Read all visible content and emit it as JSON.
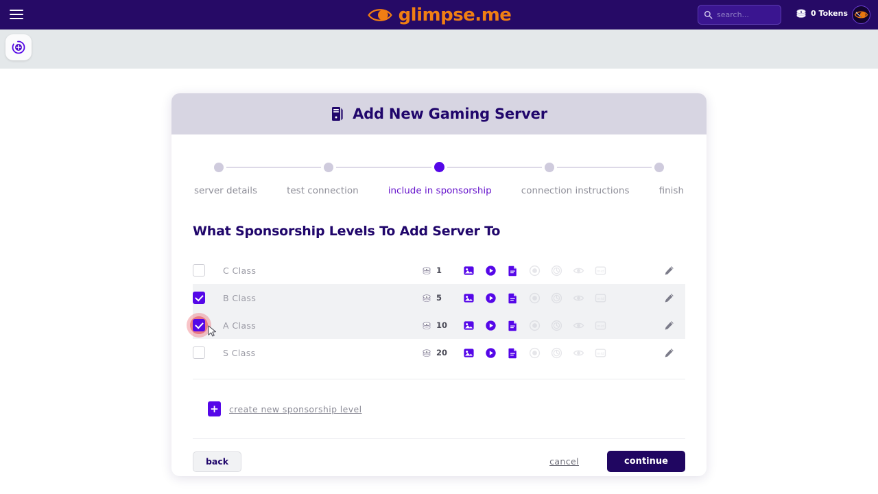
{
  "topbar": {
    "menu_icon": "hamburger-icon",
    "brand": "glimpse.me",
    "brand_icon": "eye-logo-icon",
    "search": {
      "value": "",
      "placeholder": "search..."
    },
    "tokens_label": "0 Tokens",
    "tokens_icon": "coin-stack-icon",
    "avatar_icon": "user-avatar-eye-icon"
  },
  "fab": {
    "icon": "add-circle-icon"
  },
  "modal": {
    "title": "Add New Gaming Server",
    "title_icon": "server-tower-icon",
    "stepper": {
      "active_index": 2,
      "steps": [
        {
          "label": "server details"
        },
        {
          "label": "test connection"
        },
        {
          "label": "include in sponsorship"
        },
        {
          "label": "connection instructions"
        },
        {
          "label": "finish"
        }
      ]
    },
    "section_title": "What Sponsorship Levels To Add Server To",
    "levels": [
      {
        "name": "C Class",
        "checked": false,
        "shaded": false,
        "cost": "1",
        "features": [
          {
            "icon": "image-icon",
            "enabled": true
          },
          {
            "icon": "video-play-icon",
            "enabled": true
          },
          {
            "icon": "document-icon",
            "enabled": true
          },
          {
            "icon": "audio-record-icon",
            "enabled": false
          },
          {
            "icon": "audio-clock-icon",
            "enabled": false
          },
          {
            "icon": "eye-view-icon",
            "enabled": false
          },
          {
            "icon": "midi-icon",
            "enabled": false
          }
        ],
        "edit_icon": "pencil-icon"
      },
      {
        "name": "B Class",
        "checked": true,
        "shaded": true,
        "cost": "5",
        "features": [
          {
            "icon": "image-icon",
            "enabled": true
          },
          {
            "icon": "video-play-icon",
            "enabled": true
          },
          {
            "icon": "document-icon",
            "enabled": true
          },
          {
            "icon": "audio-record-icon",
            "enabled": false
          },
          {
            "icon": "audio-clock-icon",
            "enabled": false
          },
          {
            "icon": "eye-view-icon",
            "enabled": false
          },
          {
            "icon": "midi-icon",
            "enabled": false
          }
        ],
        "edit_icon": "pencil-icon"
      },
      {
        "name": "A Class",
        "checked": true,
        "shaded": true,
        "cost": "10",
        "clicked": true,
        "features": [
          {
            "icon": "image-icon",
            "enabled": true
          },
          {
            "icon": "video-play-icon",
            "enabled": true
          },
          {
            "icon": "document-icon",
            "enabled": true
          },
          {
            "icon": "audio-record-icon",
            "enabled": false
          },
          {
            "icon": "audio-clock-icon",
            "enabled": false
          },
          {
            "icon": "eye-view-icon",
            "enabled": false
          },
          {
            "icon": "midi-icon",
            "enabled": false
          }
        ],
        "edit_icon": "pencil-icon"
      },
      {
        "name": "S Class",
        "checked": false,
        "shaded": false,
        "cost": "20",
        "features": [
          {
            "icon": "image-icon",
            "enabled": true
          },
          {
            "icon": "video-play-icon",
            "enabled": true
          },
          {
            "icon": "document-icon",
            "enabled": true
          },
          {
            "icon": "audio-record-icon",
            "enabled": false
          },
          {
            "icon": "audio-clock-icon",
            "enabled": false
          },
          {
            "icon": "eye-view-icon",
            "enabled": false
          },
          {
            "icon": "midi-icon",
            "enabled": false
          }
        ],
        "edit_icon": "pencil-icon"
      }
    ],
    "create_new": {
      "label": "create new sponsorship level",
      "icon": "plus-icon"
    },
    "footer": {
      "back_label": "back",
      "cancel_label": "cancel",
      "continue_label": "continue"
    }
  },
  "colors": {
    "brand_orange": "#f07e13",
    "nav_purple": "#260a66",
    "accent_purple": "#5507e8",
    "title_purple": "#20066b",
    "active_step": "#6614cc",
    "row_shade": "#f1f2f4",
    "header_band": "#d7d5e2",
    "sub_band": "#e4e8ea",
    "click_ripple": "#e23c4b"
  }
}
